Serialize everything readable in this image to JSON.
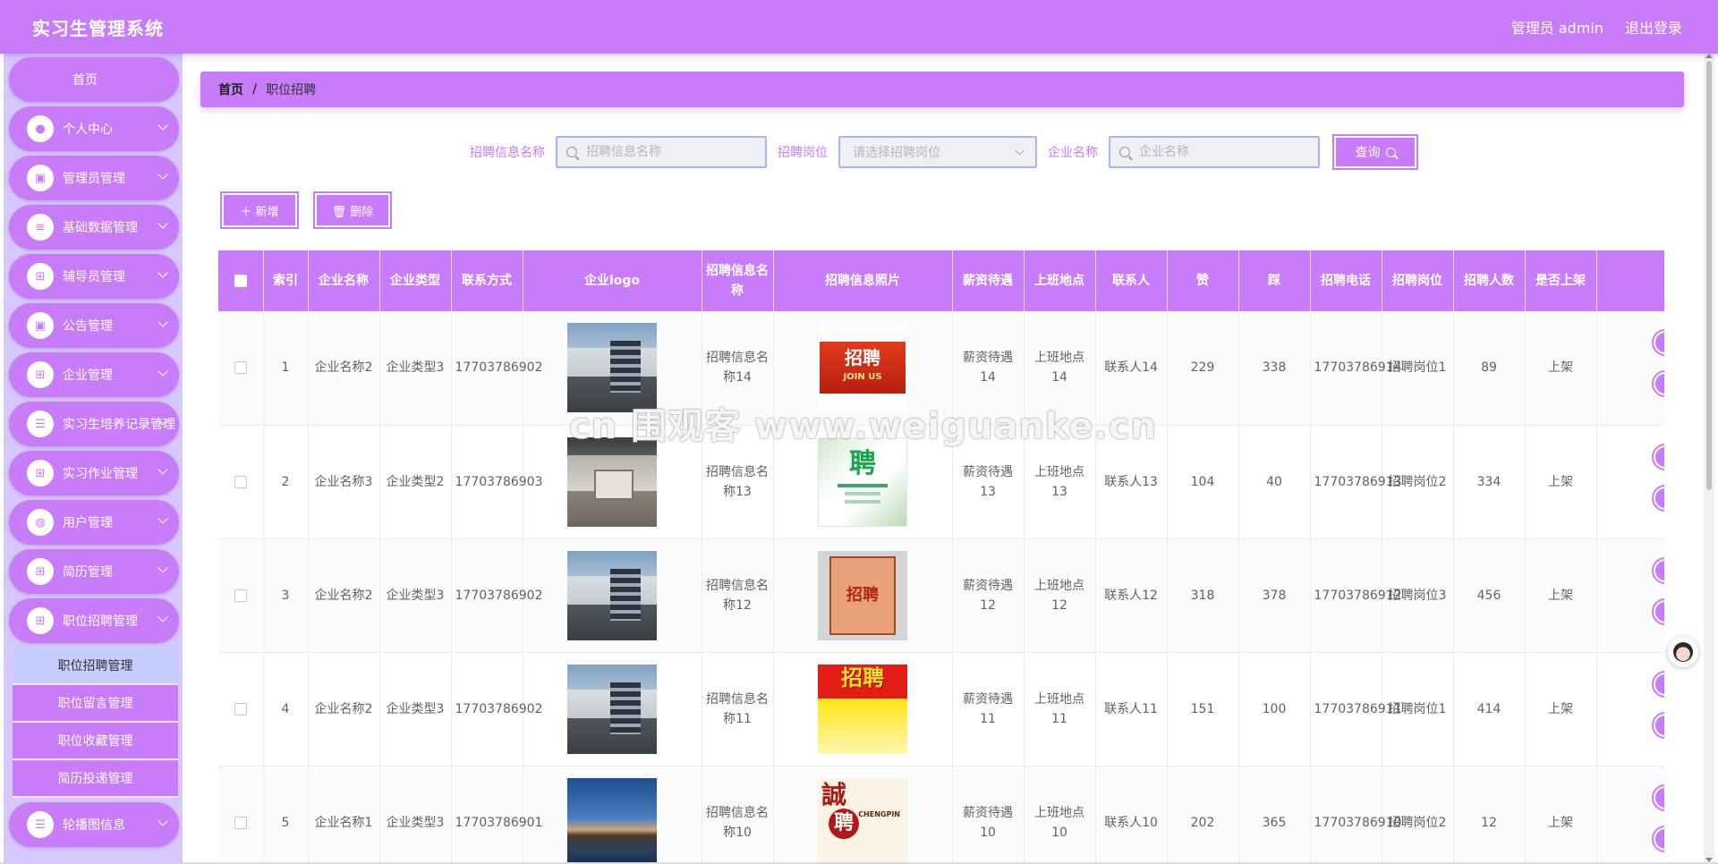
{
  "header": {
    "title": "实习生管理系统",
    "user": "管理员 admin",
    "logout": "退出登录"
  },
  "sidebar": {
    "home": "首页",
    "items": [
      {
        "label": "个人中心",
        "icon": "user-icon"
      },
      {
        "label": "管理员管理",
        "icon": "clipboard-icon"
      },
      {
        "label": "基础数据管理",
        "icon": "sliders-icon"
      },
      {
        "label": "辅导员管理",
        "icon": "grid-icon"
      },
      {
        "label": "公告管理",
        "icon": "clipboard-check-icon"
      },
      {
        "label": "企业管理",
        "icon": "grid-dots-icon"
      },
      {
        "label": "实习生培养记录管理",
        "icon": "list-icon"
      },
      {
        "label": "实习作业管理",
        "icon": "grid-icon"
      },
      {
        "label": "用户管理",
        "icon": "bulb-icon"
      },
      {
        "label": "简历管理",
        "icon": "grid-icon"
      },
      {
        "label": "职位招聘管理",
        "icon": "grid-icon"
      }
    ],
    "submenu": [
      {
        "label": "职位招聘管理",
        "active": true
      },
      {
        "label": "职位留言管理",
        "active": false
      },
      {
        "label": "职位收藏管理",
        "active": false
      },
      {
        "label": "简历投递管理",
        "active": false
      }
    ],
    "last_item": {
      "label": "轮播图信息",
      "icon": "list-icon"
    }
  },
  "breadcrumb": {
    "home": "首页",
    "sep": "/",
    "current": "职位招聘"
  },
  "search": {
    "name_label": "招聘信息名称",
    "name_placeholder": "招聘信息名称",
    "post_label": "招聘岗位",
    "post_placeholder": "请选择招聘岗位",
    "company_label": "企业名称",
    "company_placeholder": "企业名称",
    "query_button": "查询"
  },
  "actions": {
    "add": "＋ 新增",
    "delete": "🗑 删除"
  },
  "table": {
    "headers": [
      "索引",
      "企业名称",
      "企业类型",
      "联系方式",
      "企业logo",
      "招聘信息名称",
      "招聘信息照片",
      "薪资待遇",
      "上班地点",
      "联系人",
      "赞",
      "踩",
      "招聘电话",
      "招聘岗位",
      "招聘人数",
      "是否上架"
    ],
    "rows": [
      {
        "index": "1",
        "company": "企业名称2",
        "type": "企业类型3",
        "phone": "17703786902",
        "logo": "building",
        "name": "招聘信息名称14",
        "photo": "zp1",
        "salary": "薪资待遇14",
        "place": "上班地点14",
        "contact": "联系人14",
        "like": "229",
        "dislike": "338",
        "tel": "17703786914",
        "post": "招聘岗位1",
        "count": "89",
        "status": "上架"
      },
      {
        "index": "2",
        "company": "企业名称3",
        "type": "企业类型2",
        "phone": "17703786903",
        "logo": "office",
        "name": "招聘信息名称13",
        "photo": "zp2",
        "salary": "薪资待遇13",
        "place": "上班地点13",
        "contact": "联系人13",
        "like": "104",
        "dislike": "40",
        "tel": "17703786913",
        "post": "招聘岗位2",
        "count": "334",
        "status": "上架"
      },
      {
        "index": "3",
        "company": "企业名称2",
        "type": "企业类型3",
        "phone": "17703786902",
        "logo": "building",
        "name": "招聘信息名称12",
        "photo": "zp3",
        "salary": "薪资待遇12",
        "place": "上班地点12",
        "contact": "联系人12",
        "like": "318",
        "dislike": "378",
        "tel": "17703786912",
        "post": "招聘岗位3",
        "count": "456",
        "status": "上架"
      },
      {
        "index": "4",
        "company": "企业名称2",
        "type": "企业类型3",
        "phone": "17703786902",
        "logo": "building",
        "name": "招聘信息名称11",
        "photo": "zp4",
        "salary": "薪资待遇11",
        "place": "上班地点11",
        "contact": "联系人11",
        "like": "151",
        "dislike": "100",
        "tel": "17703786911",
        "post": "招聘岗位1",
        "count": "414",
        "status": "上架"
      },
      {
        "index": "5",
        "company": "企业名称1",
        "type": "企业类型3",
        "phone": "17703786901",
        "logo": "night",
        "name": "招聘信息名称10",
        "photo": "zp5",
        "salary": "薪资待遇10",
        "place": "上班地点10",
        "contact": "联系人10",
        "like": "202",
        "dislike": "365",
        "tel": "17703786910",
        "post": "招聘岗位2",
        "count": "12",
        "status": "上架"
      }
    ]
  },
  "images": {
    "zp1_main": "招聘",
    "zp1_sub": "JOIN US",
    "zp2_main": "聘",
    "zp3_main": "招聘",
    "zp4_main": "招聘",
    "zp5_main": "誠",
    "zp5_sub": "聘",
    "zp5_en": "CHENGPIN"
  },
  "watermark": "cn 围观客 www.weiguanke.cn",
  "colors": {
    "primary": "#c97cf9",
    "sidebar_bg": "#d6c8fb",
    "submenu_active": "#c7cdfc"
  }
}
